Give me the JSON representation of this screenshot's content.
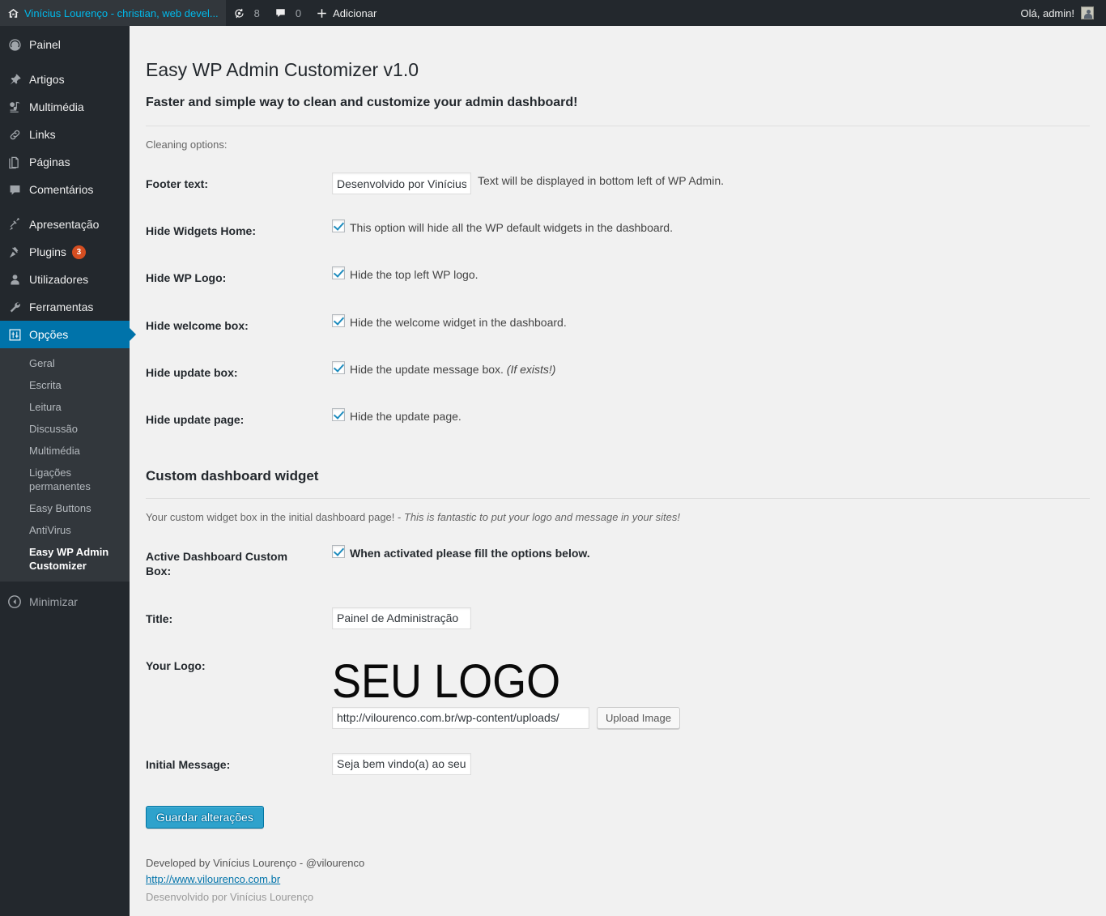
{
  "adminbar": {
    "home_icon": "home-icon",
    "site_title": "Vinícius Lourenço - christian, web devel...",
    "updates_icon": "updates-icon",
    "updates_count": "8",
    "comments_icon": "comment-bubble-icon",
    "comments_count": "0",
    "new_icon": "plus-icon",
    "new_label": "Adicionar",
    "greeting": "Olá, admin!",
    "avatar": "user-avatar"
  },
  "sidebar": {
    "items": [
      {
        "label": "Painel",
        "icon": "dashboard-icon",
        "current": false
      },
      {
        "label": "Artigos",
        "icon": "pin-icon",
        "current": false
      },
      {
        "label": "Multimédia",
        "icon": "media-icon",
        "current": false
      },
      {
        "label": "Links",
        "icon": "link-icon",
        "current": false
      },
      {
        "label": "Páginas",
        "icon": "pages-icon",
        "current": false
      },
      {
        "label": "Comentários",
        "icon": "comment-icon",
        "current": false
      },
      {
        "label": "Apresentação",
        "icon": "appearance-icon",
        "current": false
      },
      {
        "label": "Plugins",
        "icon": "plugins-icon",
        "current": false,
        "badge": "3"
      },
      {
        "label": "Utilizadores",
        "icon": "users-icon",
        "current": false
      },
      {
        "label": "Ferramentas",
        "icon": "tools-icon",
        "current": false
      },
      {
        "label": "Opções",
        "icon": "settings-icon",
        "current": true
      }
    ],
    "submenu": [
      {
        "label": "Geral",
        "current": false
      },
      {
        "label": "Escrita",
        "current": false
      },
      {
        "label": "Leitura",
        "current": false
      },
      {
        "label": "Discussão",
        "current": false
      },
      {
        "label": "Multimédia",
        "current": false
      },
      {
        "label": "Ligações permanentes",
        "current": false
      },
      {
        "label": "Easy Buttons",
        "current": false
      },
      {
        "label": "AntiVirus",
        "current": false
      },
      {
        "label": "Easy WP Admin Customizer",
        "current": true
      }
    ],
    "collapse_label": "Minimizar",
    "collapse_icon": "collapse-arrow-icon"
  },
  "page": {
    "title": "Easy WP Admin Customizer v1.0",
    "subtitle": "Faster and simple way to clean and customize your admin dashboard!",
    "cleaning_options_label": "Cleaning options:"
  },
  "cleaning": {
    "footer_text": {
      "label": "Footer text:",
      "value": "Desenvolvido por Vinícius Lourenço",
      "hint": "Text will be displayed in bottom left of WP Admin."
    },
    "hide_widgets_home": {
      "label": "Hide Widgets Home:",
      "checked": true,
      "hint": "This option will hide all the WP default widgets in the dashboard."
    },
    "hide_wp_logo": {
      "label": "Hide WP Logo:",
      "checked": true,
      "hint": "Hide the top left WP logo."
    },
    "hide_welcome_box": {
      "label": "Hide welcome box:",
      "checked": true,
      "hint": "Hide the welcome widget in the dashboard."
    },
    "hide_update_box": {
      "label": "Hide update box:",
      "checked": true,
      "hint": "Hide the update message box.",
      "hint_em": "(If exists!)"
    },
    "hide_update_page": {
      "label": "Hide update page:",
      "checked": true,
      "hint": "Hide the update page."
    }
  },
  "custom_widget": {
    "section_title": "Custom dashboard widget",
    "description": "Your custom widget box in the initial dashboard page! - ",
    "description_em": "This is fantastic to put your logo and message in your sites!",
    "active_box": {
      "label": "Active Dashboard Custom Box:",
      "checked": true,
      "hint": "When activated please fill the options below."
    },
    "title_field": {
      "label": "Title:",
      "value": "Painel de Administração"
    },
    "logo": {
      "label": "Your Logo:",
      "preview_text": "SEU LOGO",
      "url_value": "http://vilourenco.com.br/wp-content/uploads/",
      "upload_button": "Upload Image"
    },
    "initial_message": {
      "label": "Initial Message:",
      "value": "Seja bem vindo(a) ao seu"
    }
  },
  "actions": {
    "save_label": "Guardar alterações"
  },
  "credits": {
    "line1": "Developed by Vinícius Lourenço - @vilourenco",
    "link": "http://www.vilourenco.com.br"
  },
  "footer": {
    "text": "Desenvolvido por Vinícius Lourenço"
  },
  "colors": {
    "sidebar_bg": "#23282d",
    "submenu_bg": "#32373c",
    "accent": "#0073aa",
    "button": "#2ea2cc",
    "badge": "#d54e21",
    "content_bg": "#f1f1f1"
  }
}
